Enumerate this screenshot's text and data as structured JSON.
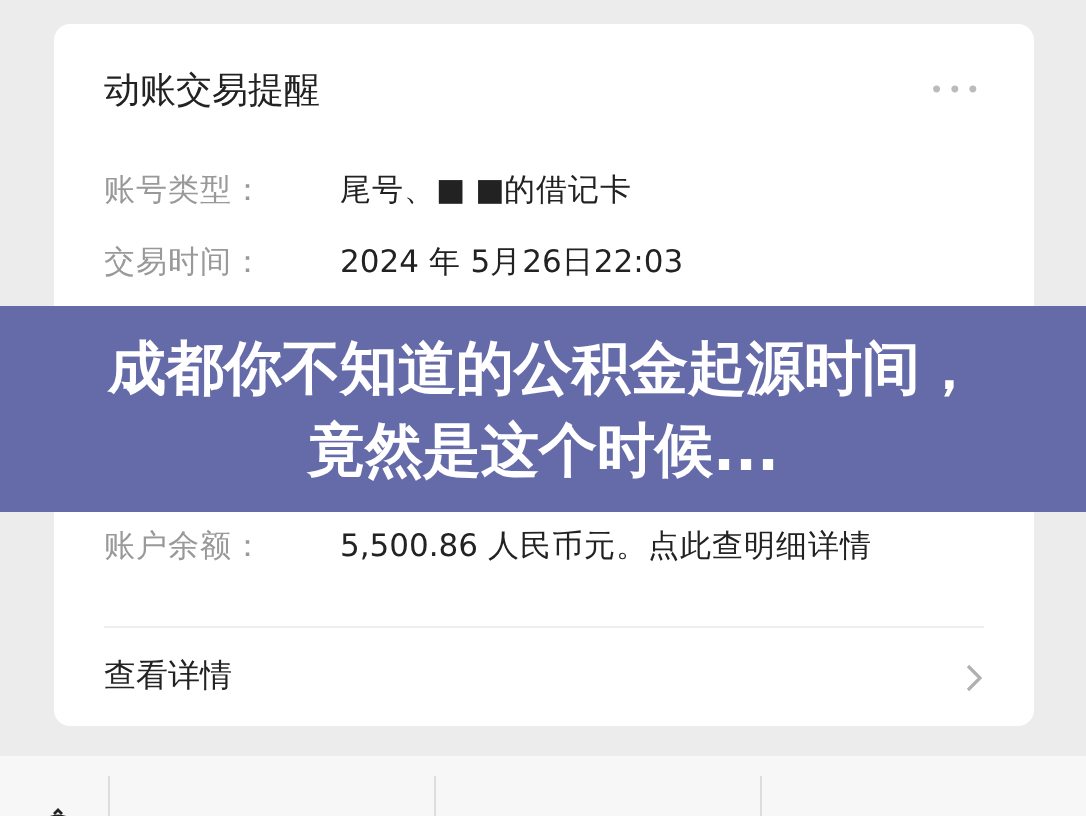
{
  "card": {
    "title": "动账交易提醒",
    "more": "•••",
    "rows": [
      {
        "label": "账号类型：",
        "value": "尾号、■ ■的借记卡"
      },
      {
        "label": "交易时间：",
        "value": "2024 年 5月26日22:03"
      },
      {
        "label": "账户余额：",
        "value": "5,500.86 人民币元。点此查明细详情"
      }
    ],
    "link": "查看详情"
  },
  "banner": {
    "title": "成都你不知道的公积金起源时间，竟然是这个时候..."
  }
}
